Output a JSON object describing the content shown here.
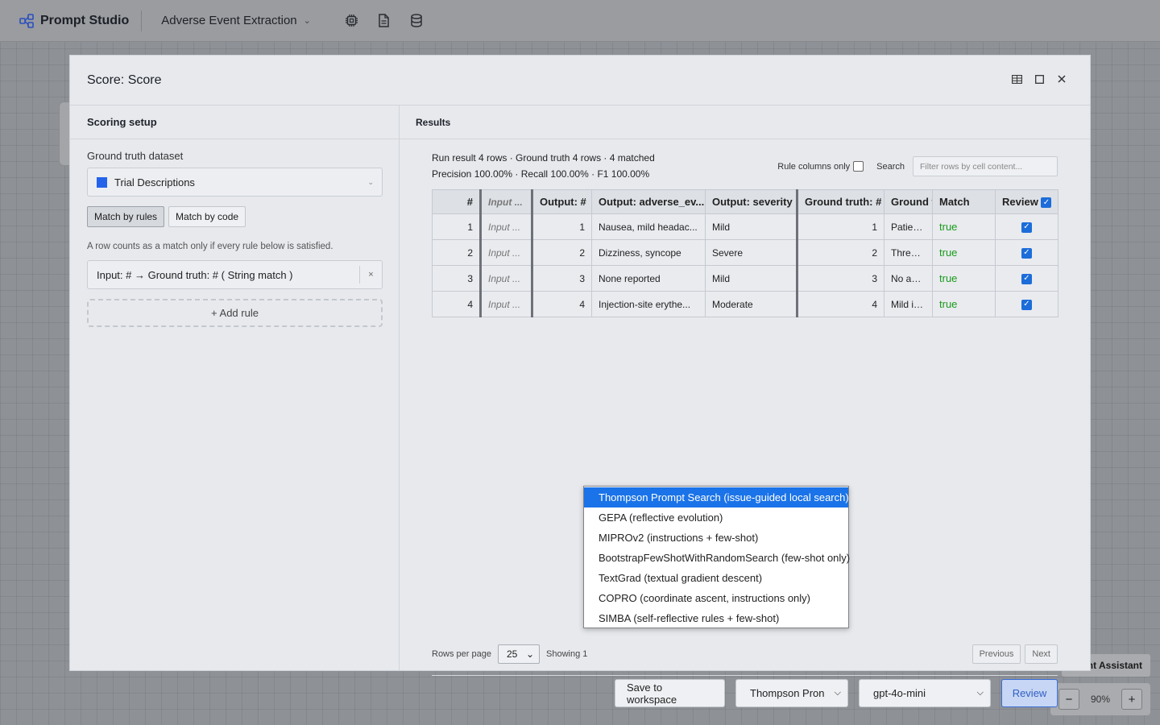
{
  "app": {
    "name": "Prompt Studio",
    "project": "Adverse Event Extraction"
  },
  "toolbar_icons": [
    "chip-icon",
    "document-icon",
    "database-icon"
  ],
  "modal": {
    "title": "Score: Score",
    "left": {
      "heading": "Scoring setup",
      "dataset_label": "Ground truth dataset",
      "dataset_value": "Trial Descriptions",
      "dataset_color": "#2563eb",
      "match_by_rules": "Match by rules",
      "match_by_code": "Match by code",
      "hint": "A row counts as a match only if every rule below is satisfied.",
      "rule": "Input: # → Ground truth: # ( String match )",
      "rule_remove": "×",
      "add_rule": "+ Add rule"
    },
    "right": {
      "heading": "Results",
      "stats_line1": "Run result 4 rows · Ground truth 4 rows · 4 matched",
      "stats_line2": "Precision 100.00% · Recall 100.00% · F1 100.00%",
      "rule_columns_only": "Rule columns only",
      "search_label": "Search",
      "search_placeholder": "Filter rows by cell content...",
      "columns": [
        "#",
        "Input ...",
        "Output: #",
        "Output: adverse_ev...",
        "Output: severity",
        "Ground truth: #",
        "Ground t",
        "Match",
        "Review"
      ],
      "rows": [
        {
          "idx": "1",
          "input": "Input ...",
          "out_num": "1",
          "out_ae": "Nausea, mild headac...",
          "severity": "Mild",
          "gt_num": "1",
          "gt_text": "Patients r",
          "match": "true",
          "review": true
        },
        {
          "idx": "2",
          "input": "Input ...",
          "out_num": "2",
          "out_ae": "Dizziness, syncope",
          "severity": "Severe",
          "gt_num": "2",
          "gt_text": "Three pa",
          "match": "true",
          "review": true
        },
        {
          "idx": "3",
          "input": "Input ...",
          "out_num": "3",
          "out_ae": "None reported",
          "severity": "Mild",
          "gt_num": "3",
          "gt_text": "No adver",
          "match": "true",
          "review": true
        },
        {
          "idx": "4",
          "input": "Input ...",
          "out_num": "4",
          "out_ae": "Injection-site erythe...",
          "severity": "Moderate",
          "gt_num": "4",
          "gt_text": "Mild injec",
          "match": "true",
          "review": true
        }
      ],
      "rows_per_page_label": "Rows per page",
      "rows_per_page": "25",
      "showing": "Showing 1",
      "prev": "Previous",
      "next": "Next",
      "save": "Save to workspace",
      "optimizer_value": "Thompson Pron",
      "model_value": "gpt-4o-mini",
      "review_button": "Review"
    }
  },
  "optimizer_options": [
    "Thompson Prompt Search (issue-guided local search)",
    "GEPA (reflective evolution)",
    "MIPROv2 (instructions + few-shot)",
    "BootstrapFewShotWithRandomSearch (few-shot only)",
    "TextGrad (textual gradient descent)",
    "COPRO (coordinate ascent, instructions only)",
    "SIMBA (self-reflective rules + few-shot)"
  ],
  "selected_option_index": 0,
  "background": {
    "assistant_label": "nt Assistant",
    "zoom": "90%",
    "zoom_out": "−",
    "zoom_in": "+"
  }
}
